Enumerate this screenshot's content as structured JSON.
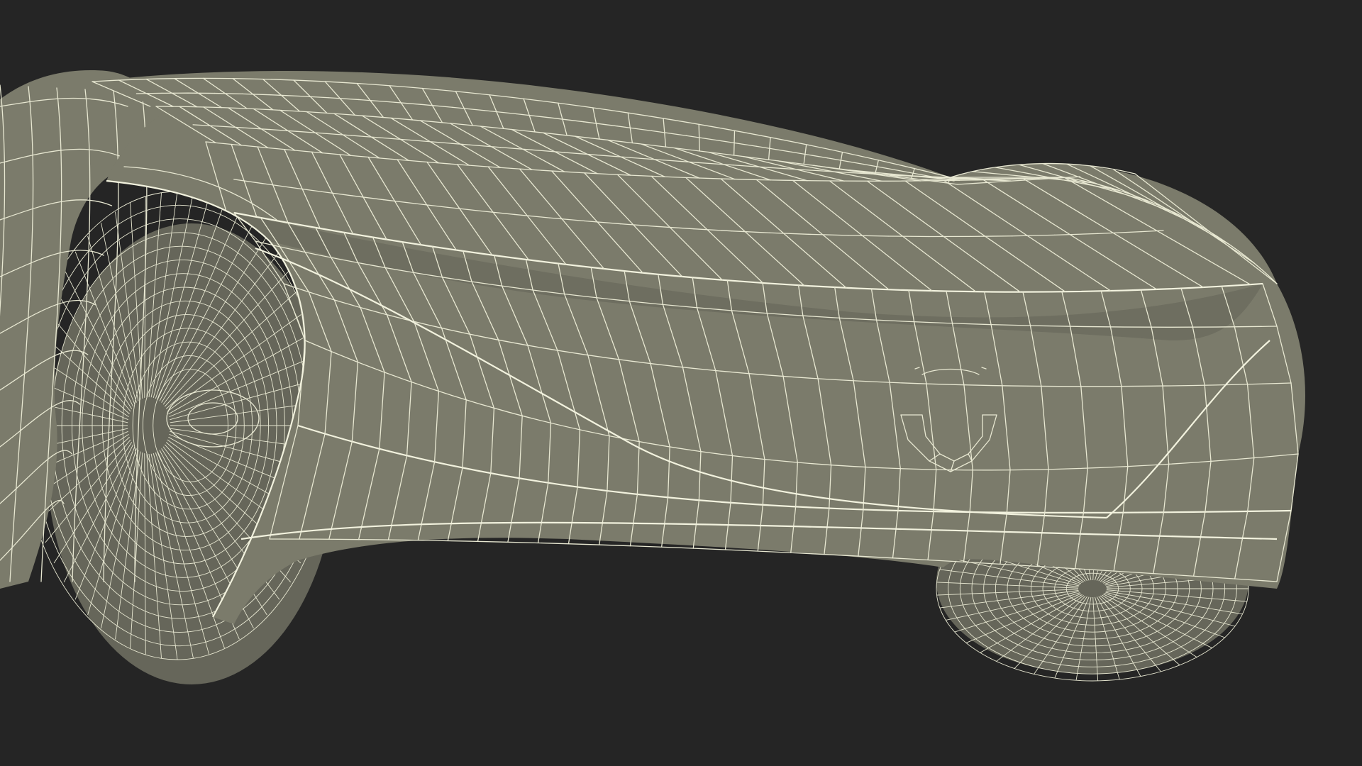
{
  "scene": {
    "subject": "car-wireframe-render",
    "background_color": "#252525",
    "surface_color": "#7b7b6b",
    "wire_color": "#e8e8d2"
  }
}
